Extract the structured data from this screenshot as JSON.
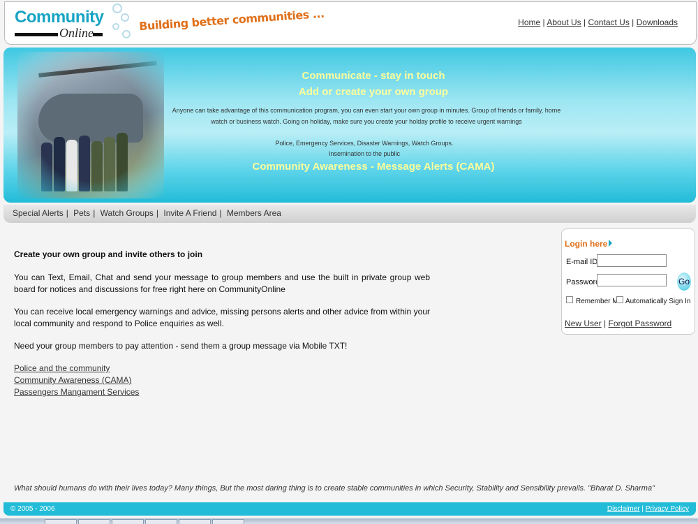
{
  "header": {
    "logo_word1": "Community",
    "logo_word2": "Online",
    "tagline": "Building better communities ...",
    "links": [
      "Home",
      "About Us",
      "Contact Us",
      "Downloads"
    ]
  },
  "banner": {
    "heading1": "Communicate - stay in touch",
    "heading2": "Add or create your own group",
    "text1": "Anyone can take advantage of this communication program, you can even start your own group in minutes. Group of friends or family, home watch or business watch. Going on holiday, make sure you create your holday profile to receive urgent warnings",
    "text2": "Police, Emergency Services, Disaster Warnings, Watch Groups.",
    "text3": "Insemination to the public",
    "heading3": "Community Awareness - Message Alerts (CAMA)"
  },
  "nav": [
    "Special Alerts",
    "Pets",
    "Watch Groups",
    "Invite A Friend",
    "Members Area"
  ],
  "content": {
    "heading": "Create your own group and invite others to join",
    "para1": "You can Text, Email, Chat and send your message to group members and use the built in private group web board for notices and discussions for free right here on CommunityOnline",
    "para2": "You can receive local emergency warnings and advice, missing persons alerts and other advice from within your local community and respond to Police enquiries as well.",
    "para3": "Need your group members to pay attention - send them a group message via Mobile TXT!",
    "links": [
      "Police and the community",
      "Community Awareness (CAMA)",
      "Passengers Mangament Services"
    ]
  },
  "login": {
    "title": "Login here",
    "email_label": "E-mail ID:",
    "password_label": "Password:",
    "go_label": "Go",
    "remember_label": "Remember ME",
    "auto_label": "Automatically Sign In",
    "new_user": "New User",
    "forgot": "Forgot Password"
  },
  "quote": "What should humans do with their lives today? Many things, But the most daring thing is to create stable communities in which Security, Stability and Sensibility prevails. \"Bharat D. Sharma\"",
  "footer": {
    "copyright": "© 2005 - 2006",
    "disclaimer": "Disclaimer",
    "privacy": "Privacy Policy"
  }
}
